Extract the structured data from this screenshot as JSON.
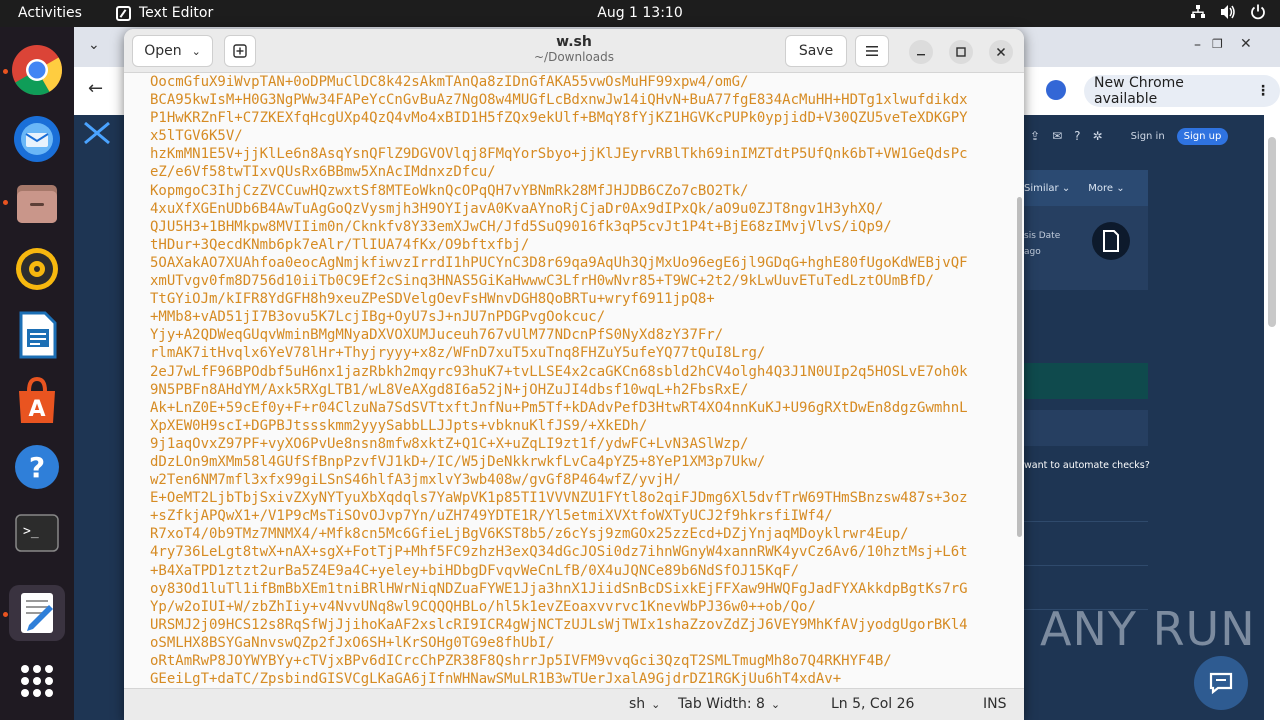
{
  "topbar": {
    "activities": "Activities",
    "app_name": "Text Editor",
    "clock": "Aug 1  13:10"
  },
  "dock": {
    "apps": [
      "chrome-icon",
      "thunderbird-icon",
      "files-icon",
      "rhythmbox-icon",
      "libreoffice-writer-icon",
      "app-center-icon",
      "help-icon",
      "terminal-icon",
      "text-editor-icon",
      "app-grid-icon"
    ]
  },
  "chrome": {
    "new_chrome": "New Chrome available",
    "sign_in": "Sign in",
    "sign_up": "Sign up",
    "similar": "Similar",
    "more": "More",
    "analysis_date_fragment": "sis Date",
    "ago_fragment": "ago",
    "automate_text": "want to automate checks?",
    "watermark": "ANY RUN"
  },
  "editor": {
    "open_label": "Open",
    "save_label": "Save",
    "file_name": "w.sh",
    "file_path": "~/Downloads",
    "lines": [
      "OocmGfuX9iWvpTAN+0oDPMuClDC8k42sAkmTAnQa8zIDnGfAKA55vwOsMuHF99xpw4/omG/",
      "BCA95kwIsM+H0G3NgPWw34FAPeYcCnGvBuAz7NgO8w4MUGfLcBdxnwJw14iQHvN+BuA77fgE834AcMuHH+HDTg1xlwufdikdx",
      "P1HwKRZnFl+C7ZKEXfqHcgUXp4QzQ4vMo4xBID1H5fZQx9ekUlf+BMqY8fYjKZ1HGVKcPUPk0ypjidD+V30QZU5veTeXDKGPY",
      "x5lTGV6K5V/",
      "hzKmMN1E5V+jjKlLe6n8AsqYsnQFlZ9DGVOVlqj8FMqYorSbyo+jjKlJEyrvRBlTkh69inIMZTdtP5UfQnk6bT+VW1GeQdsPc",
      "eZ/e6Vf58twTIxvQUsRx6BBmw5XnAcIMdnxzDfcu/",
      "KopmgoC3IhjCzZVCCuwHQzwxtSf8MTEoWknQcOPqQH7vYBNmRk28MfJHJDB6CZo7cBO2Tk/",
      "4xuXfXGEnUDb6B4AwTuAgGoQzVysmjh3H9OYIjavA0KvaAYnoRjCjaDr0Ax9dIPxQk/aO9u0ZJT8ngv1H3yhXQ/",
      "QJU5H3+1BHMkpw8MVIIim0n/Cknkfv8Y33emXJwCH/Jfd5SuQ9016fk3qP5cvJt1P4t+BjE68zIMvjVlvS/iQp9/",
      "tHDur+3QecdKNmb6pk7eAlr/TlIUA74fKx/O9bftxfbj/",
      "5OAXakAO7XUAhfoa0eocAgNmjkfiwvzIrrdI1hPUCYnC3D8r69qa9AqUh3QjMxUo96egE6jl9GDqG+hghE80fUgoKdWEBjvQF",
      "xmUTvgv0fm8D756d10iiTb0C9Ef2cSinq3HNAS5GiKaHwwwC3LfrH0wNvr85+T9WC+2t2/9kLwUuvETuTedLztOUmBfD/",
      "TtGYiOJm/kIFR8YdGFH8h9xeuZPeSDVelgOevFsHWnvDGH8QoBRTu+wryf6911jpQ8+",
      "+MMb8+vAD51jI7B3ovu5K7LcjIBg+OyU7sJ+nJU7nPDGPvgOokcuc/",
      "Yjy+A2QDWeqGUqvWminBMgMNyaDXVOXUMJuceuh767vUlM77NDcnPfS0NyXd8zY37Fr/",
      "rlmAK7itHvqlx6YeV78lHr+Thyjryyy+x8z/WFnD7xuT5xuTnq8FHZuY5ufeYQ77tQuI8Lrg/",
      "2eJ7wLfF96BPOdbf5uH6nx1jazRbkh2mqyrc93huK7+tvLLSE4x2caGKCn68sbld2hCV4olgh4Q3J1N0UIp2q5HOSLvE7oh0k",
      "9N5PBFn8AHdYM/Axk5RXgLTB1/wL8VeAXgd8I6a52jN+jOHZuJI4dbsf10wqL+h2FbsRxE/",
      "Ak+LnZ0E+59cEf0y+F+r04ClzuNa7SdSVTtxftJnfNu+Pm5Tf+kDAdvPefD3HtwRT4XO4nnKuKJ+U96gRXtDwEn8dgzGwmhnL",
      "XpXEW0H9scI+DGPBJtssskmm2yyySabbLLJJpts+vbknuKlfJS9/+XkEDh/",
      "9j1aqOvxZ97PF+vyXO6PvUe8nsn8mfw8xktZ+Q1C+X+uZqLI9zt1f/ydwFC+LvN3ASlWzp/",
      "dDzLOn9mXMm58l4GUfSfBnpPzvfVJ1kD+/IC/W5jDeNkkrwkfLvCa4pYZ5+8YeP1XM3p7Ukw/",
      "w2Ten6NM7mfl3xfx99giLSnS46hlfA3jmxlvY3wb408w/gvGf8P464wfZ/yvjH/",
      "E+OeMT2LjbTbjSxivZXyNYTyuXbXqdqls7YaWpVK1p85TI1VVVNZU1FYtl8o2qiFJDmg6Xl5dvfTrW69THmSBnzsw487s+3oz",
      "+sZfkjAPQwX1+/V1P9cMsTiSOvOJvp7Yn/uZH749YDTE1R/Yl5etmiXVXtfoWXTyUCJ2f9hkrsfiIWf4/",
      "R7xoT4/0b9TMz7MNMX4/+Mfk8cn5Mc6GfieLjBgV6KST8b5/z6cYsj9zmGOx25zzEcd+DZjYnjaqMDoyklrwr4Eup/",
      "4ry736LeLgt8twX+nAX+sgX+FotTjP+Mhf5FC9zhzH3exQ34dGcJOSi0dz7ihnWGnyW4xannRWK4yvCz6Av6/10hztMsj+L6t",
      "+B4XaTPD1ztzt2urBa5Z4E9a4C+yeley+biHDbgDFvqvWeCnLfB/0X4uJQNCe89b6NdSfOJ15KqF/",
      "oy83Od1luTl1ifBmBbXEm1tniBRlHWrNiqNDZuaFYWE1Jja3hnX1JiidSnBcDSixkEjFFXaw9HWQFgJadFYXAkkdpBgtKs7rG",
      "Yp/w2oIUI+W/zbZhIiy+v4NvvUNq8wl9CQQQHBLo/hl5k1evZEoaxvvrvc1KnevWbPJ36w0++ob/Qo/",
      "URSMJ2j09HCS12s8RqSfWjJjihoKaAF2xslcRI9ICR4gWjNCTzUJLsWjTWIx1shaZzovZdZjJ6VEY9MhKfAVjyodgUgorBKl4",
      "oSMLHX8BSYGaNnvswQZp2fJxO6SH+lKrSOHg0TG9e8fhUbI/",
      "oRtAmRwP8JOYWYBYy+cTVjxBPv6dICrcChPZR38F8QshrrJp5IVFM9vvqGci3QzqT2SMLTmugMh8o7Q4RKHYF4B/",
      "GEeiLgT+daTC/ZpsbindGISVCgLKaGA6jIfnWHNawSMuLR1B3wTUerJxalA9GjdrDZ1RGKjUu6hT4xdAv+"
    ],
    "status": {
      "language": "sh",
      "tab_width": "Tab Width: 8",
      "position": "Ln 5, Col 26",
      "mode": "INS"
    }
  }
}
